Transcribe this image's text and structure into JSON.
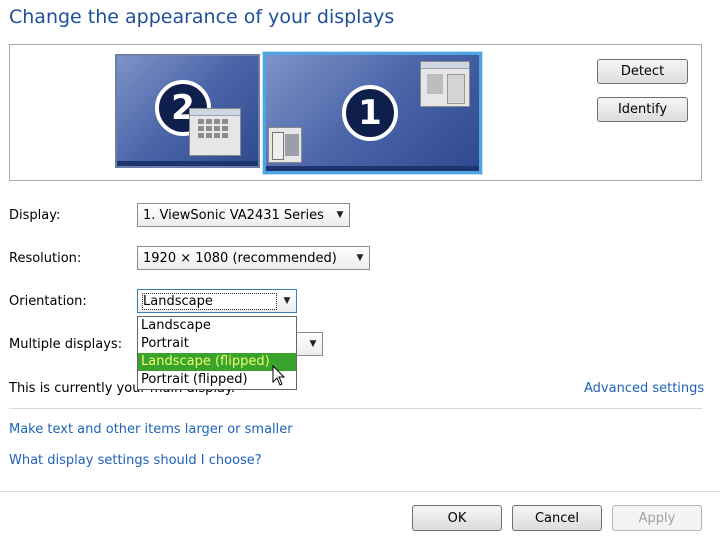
{
  "page": {
    "title": "Change the appearance of your displays"
  },
  "preview": {
    "monitors": [
      {
        "number": "2",
        "role": "secondary"
      },
      {
        "number": "1",
        "role": "primary",
        "selected": true
      }
    ],
    "detect_label": "Detect",
    "identify_label": "Identify"
  },
  "form": {
    "display": {
      "label": "Display:",
      "value": "1. ViewSonic VA2431 Series"
    },
    "resolution": {
      "label": "Resolution:",
      "value": "1920 × 1080 (recommended)"
    },
    "orientation": {
      "label": "Orientation:",
      "value": "Landscape",
      "options": [
        "Landscape",
        "Portrait",
        "Landscape (flipped)",
        "Portrait (flipped)"
      ],
      "highlighted_option": "Landscape (flipped)"
    },
    "multiple_displays": {
      "label": "Multiple displays:"
    }
  },
  "main_display_text": "This is currently your main display.",
  "links": {
    "advanced": "Advanced settings",
    "text_size": "Make text and other items larger or smaller",
    "which_settings": "What display settings should I choose?"
  },
  "footer": {
    "ok": "OK",
    "cancel": "Cancel",
    "apply": "Apply"
  },
  "colors": {
    "link": "#1e62b8",
    "title": "#1e4f9a",
    "highlight": "#3aa32d"
  },
  "icons": [
    "chevron-down-icon",
    "mouse-pointer-icon"
  ]
}
